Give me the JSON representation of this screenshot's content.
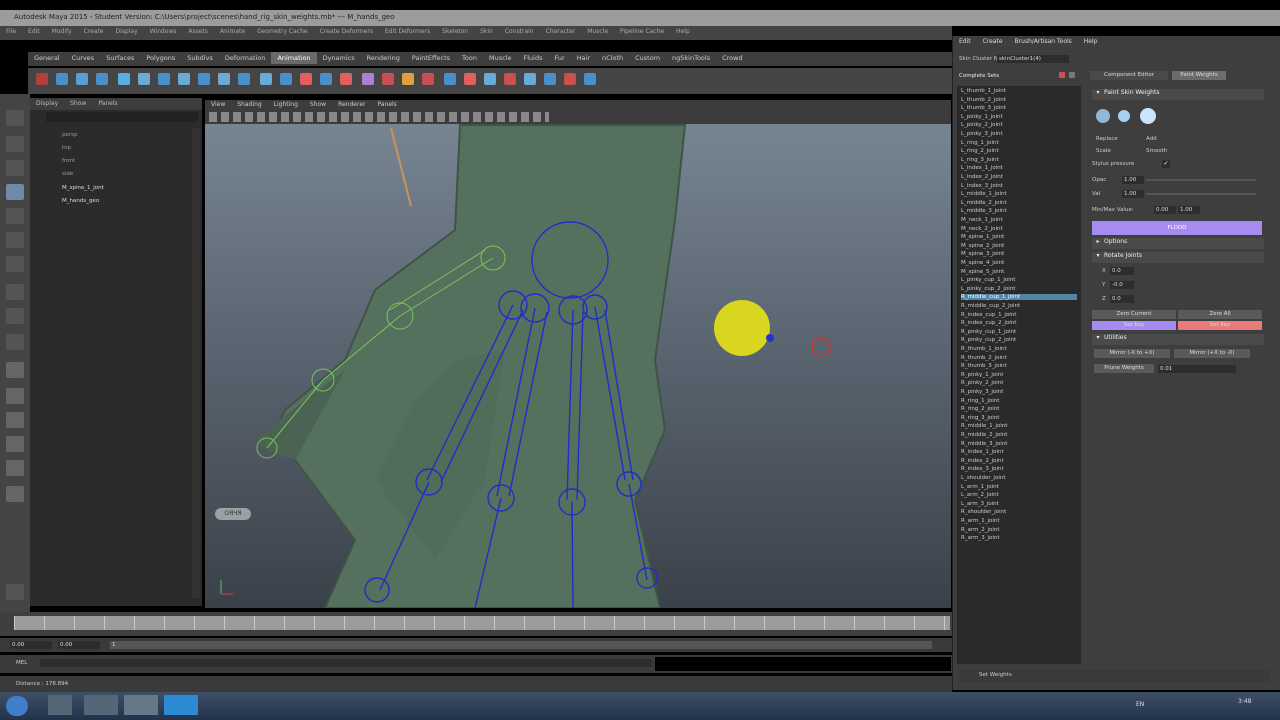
{
  "window": {
    "title": "Autodesk Maya 2015 - Student Version: C:\\Users\\project\\scenes\\hand_rig_skin_weights.mb* --- M_hands_geo"
  },
  "menubar": [
    "File",
    "Edit",
    "Modify",
    "Create",
    "Display",
    "Windows",
    "Assets",
    "Animate",
    "Geometry Cache",
    "Create Deformers",
    "Edit Deformers",
    "Skeleton",
    "Skin",
    "Constrain",
    "Character",
    "Muscle",
    "Pipeline Cache",
    "Help"
  ],
  "shelf": {
    "tabs": [
      "General",
      "Curves",
      "Surfaces",
      "Polygons",
      "Subdivs",
      "Deformation",
      "Animation",
      "Dynamics",
      "Rendering",
      "PaintEffects",
      "Toon",
      "Muscle",
      "Fluids",
      "Fur",
      "Hair",
      "nCloth",
      "Custom",
      "ngSkinTools",
      "Crowd"
    ],
    "active_tab": "Animation"
  },
  "outliner": {
    "menu": [
      "Display",
      "Show",
      "Panels"
    ],
    "items": [
      "persp",
      "top",
      "front",
      "side",
      "M_spine_1_jont",
      "M_hands_geo"
    ]
  },
  "viewport": {
    "menu": [
      "View",
      "Shading",
      "Lighting",
      "Show",
      "Renderer",
      "Panels"
    ],
    "badge": "ОЯЧЯ"
  },
  "timeline": {
    "start": "0.00",
    "end": "0.00",
    "range_start": "1"
  },
  "cmd": {
    "label": "MEL"
  },
  "help_line": {
    "text": "Distance : 178.894"
  },
  "skin_window": {
    "menu": [
      "Edit",
      "Create",
      "Brush/Artisan Tools",
      "Help"
    ],
    "cluster_label": "Skin Cluster Node:",
    "cluster_value": "skinCluster1(4)",
    "list_title": "Complete Sets",
    "joints": [
      "L_thumb_1_joint",
      "L_thumb_2_joint",
      "L_thumb_3_joint",
      "L_pinky_1_joint",
      "L_pinky_2_joint",
      "L_pinky_3_joint",
      "L_ring_1_joint",
      "L_ring_2_joint",
      "L_ring_3_joint",
      "L_index_1_joint",
      "L_index_2_joint",
      "L_index_3_joint",
      "L_middle_1_joint",
      "L_middle_2_joint",
      "L_middle_3_joint",
      "M_neck_1_joint",
      "M_neck_2_joint",
      "M_spine_1_joint",
      "M_spine_2_joint",
      "M_spine_3_joint",
      "M_spine_4_joint",
      "M_spine_5_joint",
      "L_pinky_cup_1_joint",
      "L_pinky_cup_2_joint",
      "R_middle_cup_1_joint",
      "R_middle_cup_2_joint",
      "R_index_cup_1_joint",
      "R_index_cup_2_joint",
      "R_pinky_cup_1_joint",
      "R_pinky_cup_2_joint",
      "R_thumb_1_joint",
      "R_thumb_2_joint",
      "R_thumb_3_joint",
      "R_pinky_1_joint",
      "R_pinky_2_joint",
      "R_pinky_3_joint",
      "R_ring_1_joint",
      "R_ring_2_joint",
      "R_ring_3_joint",
      "R_middle_1_joint",
      "R_middle_2_joint",
      "R_middle_3_joint",
      "R_index_1_joint",
      "R_index_2_joint",
      "R_index_3_joint",
      "L_shoulder_joint",
      "L_arm_1_joint",
      "L_arm_2_joint",
      "L_arm_3_joint",
      "R_shoulder_joint",
      "R_arm_1_joint",
      "R_arm_2_joint",
      "R_arm_3_joint"
    ],
    "selected_index": 24,
    "set_weights": "Set Weights"
  },
  "tool": {
    "tabs": [
      "Component Editor",
      "Paint Weights"
    ],
    "brush_header": "Paint Skin Weights",
    "ops": [
      "Replace",
      "Add",
      "Scale",
      "Smooth"
    ],
    "stylus": "Stylus pressure",
    "opacity_label": "Opac",
    "opacity_value": "1.00",
    "value_label": "Val",
    "value_value": "1.00",
    "minmax_label": "Min/Max Value:",
    "min_value": "0.00",
    "max_value": "1.00",
    "flood": "FLOOD",
    "options": "Options",
    "rotate": "Rotate Joints",
    "rx": "0.0",
    "ry": "-0.0",
    "rz": "0.0",
    "zero_current": "Zero Current",
    "zero_all": "Zero All",
    "set_key": "Set Key",
    "set_key2": "Set Key",
    "utilities": "Utilities",
    "mirror1": "Mirror (-X to +X)",
    "mirror2": "Mirror (+X to -X)",
    "prune": "Prune Weights",
    "prune_value": "0.01"
  },
  "taskbar": {
    "lang": "EN",
    "time": "3:48"
  },
  "colors": {
    "flood": "#a68cf0",
    "selected": "#5285a6",
    "set_key_red": "#e87a7a",
    "joint_blue": "#1f2ec9",
    "locator_yellow": "#d8d61e"
  }
}
